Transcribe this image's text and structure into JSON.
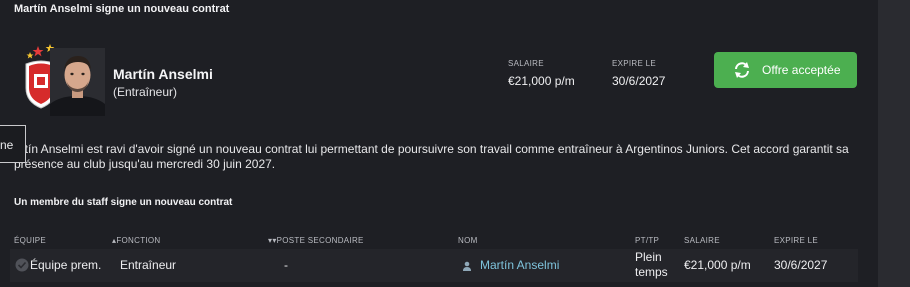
{
  "header": {
    "title": "Martín Anselmi signe un nouveau contrat"
  },
  "person": {
    "name": "Martín Anselmi",
    "role": "(Entraîneur)"
  },
  "contract": {
    "salary_label": "SALAIRE",
    "salary": "€21,000 p/m",
    "expires_label": "EXPIRE LE",
    "expires": "30/6/2027"
  },
  "action": {
    "label": "Offre acceptée",
    "icon": "refresh-icon",
    "color": "#4caf50"
  },
  "tooltip_fragment": "ne",
  "description": "artín Anselmi est ravi d'avoir signé un nouveau contrat lui permettant de poursuivre son travail comme entraîneur à Argentinos Juniors. Cet accord garantit sa présence au club jusqu'au mercredi 30 juin 2027.",
  "staff_section": {
    "title": "Un membre du staff signe un nouveau contrat",
    "columns": {
      "team": "ÉQUIPE",
      "function": "FONCTION",
      "secondary": "POSTE SECONDAIRE",
      "name": "NOM",
      "pt": "PT/TP",
      "salary": "SALAIRE",
      "expires": "EXPIRE LE"
    },
    "row": {
      "team": "Équipe prem.",
      "function": "Entraîneur",
      "secondary": "-",
      "name": "Martín Anselmi",
      "pt_line1": "Plein",
      "pt_line2": "temps",
      "salary": "€21,000 p/m",
      "expires": "30/6/2027"
    }
  }
}
